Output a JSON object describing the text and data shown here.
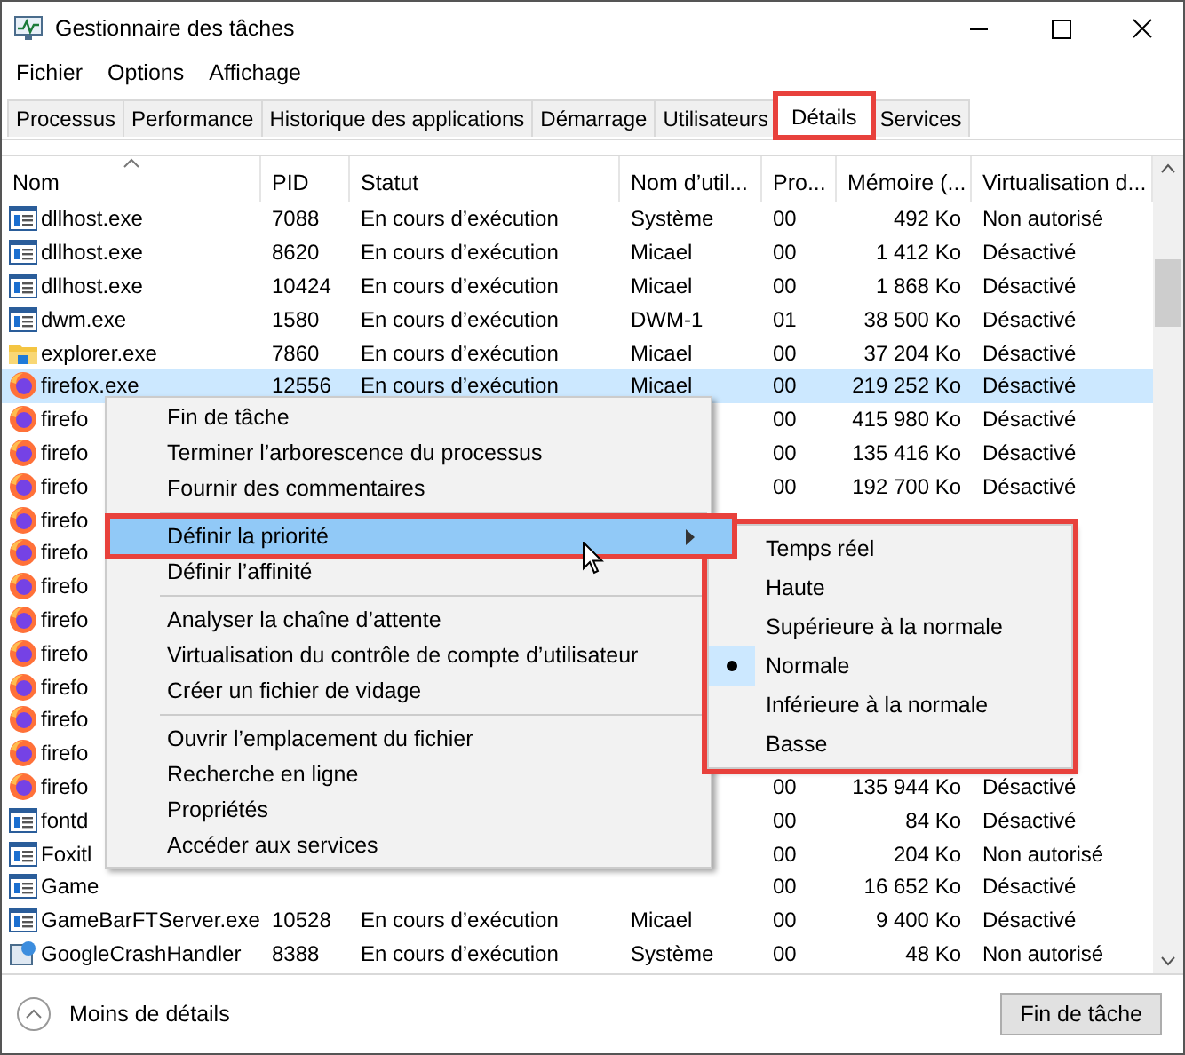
{
  "window": {
    "title": "Gestionnaire des tâches"
  },
  "menu_bar": [
    "Fichier",
    "Options",
    "Affichage"
  ],
  "tabs": [
    {
      "label": "Processus",
      "selected": false,
      "highlighted": false
    },
    {
      "label": "Performance",
      "selected": false,
      "highlighted": false
    },
    {
      "label": "Historique des applications",
      "selected": false,
      "highlighted": false
    },
    {
      "label": "Démarrage",
      "selected": false,
      "highlighted": false
    },
    {
      "label": "Utilisateurs",
      "selected": false,
      "highlighted": false
    },
    {
      "label": "Détails",
      "selected": true,
      "highlighted": true
    },
    {
      "label": "Services",
      "selected": false,
      "highlighted": false
    }
  ],
  "table": {
    "columns": [
      {
        "label": "Nom",
        "sorted": true
      },
      {
        "label": "PID",
        "sorted": false
      },
      {
        "label": "Statut",
        "sorted": false
      },
      {
        "label": "Nom d’util...",
        "sorted": false
      },
      {
        "label": "Pro...",
        "sorted": false
      },
      {
        "label": "Mémoire (...",
        "sorted": false
      },
      {
        "label": "Virtualisation d...",
        "sorted": false
      }
    ],
    "rows": [
      {
        "kind": "app",
        "selected": false,
        "name": "dllhost.exe",
        "pid": "7088",
        "status": "En cours d’exécution",
        "user": "Système",
        "cpu": "00",
        "memory": "492 Ko",
        "virtualization": "Non autorisé"
      },
      {
        "kind": "app",
        "selected": false,
        "name": "dllhost.exe",
        "pid": "8620",
        "status": "En cours d’exécution",
        "user": "Micael",
        "cpu": "00",
        "memory": "1 412 Ko",
        "virtualization": "Désactivé"
      },
      {
        "kind": "app",
        "selected": false,
        "name": "dllhost.exe",
        "pid": "10424",
        "status": "En cours d’exécution",
        "user": "Micael",
        "cpu": "00",
        "memory": "1 868 Ko",
        "virtualization": "Désactivé"
      },
      {
        "kind": "app",
        "selected": false,
        "name": "dwm.exe",
        "pid": "1580",
        "status": "En cours d’exécution",
        "user": "DWM-1",
        "cpu": "01",
        "memory": "38 500 Ko",
        "virtualization": "Désactivé"
      },
      {
        "kind": "folder",
        "selected": false,
        "name": "explorer.exe",
        "pid": "7860",
        "status": "En cours d’exécution",
        "user": "Micael",
        "cpu": "00",
        "memory": "37 204 Ko",
        "virtualization": "Désactivé"
      },
      {
        "kind": "firefox",
        "selected": true,
        "name": "firefox.exe",
        "pid": "12556",
        "status": "En cours d’exécution",
        "user": "Micael",
        "cpu": "00",
        "memory": "219 252 Ko",
        "virtualization": "Désactivé"
      },
      {
        "kind": "firefox",
        "selected": false,
        "name": "firefo",
        "cpu": "00",
        "memory": "415 980 Ko",
        "virtualization": "Désactivé"
      },
      {
        "kind": "firefox",
        "selected": false,
        "name": "firefo",
        "cpu": "00",
        "memory": "135 416 Ko",
        "virtualization": "Désactivé"
      },
      {
        "kind": "firefox",
        "selected": false,
        "name": "firefo",
        "cpu": "00",
        "memory": "192 700 Ko",
        "virtualization": "Désactivé"
      },
      {
        "kind": "firefox",
        "selected": false,
        "name": "firefo"
      },
      {
        "kind": "firefox",
        "selected": false,
        "name": "firefo"
      },
      {
        "kind": "firefox",
        "selected": false,
        "name": "firefo"
      },
      {
        "kind": "firefox",
        "selected": false,
        "name": "firefo"
      },
      {
        "kind": "firefox",
        "selected": false,
        "name": "firefo"
      },
      {
        "kind": "firefox",
        "selected": false,
        "name": "firefo"
      },
      {
        "kind": "firefox",
        "selected": false,
        "name": "firefo"
      },
      {
        "kind": "firefox",
        "selected": false,
        "name": "firefo"
      },
      {
        "kind": "firefox",
        "selected": false,
        "name": "firefo",
        "cpu": "00",
        "memory": "135 944 Ko",
        "virtualization": "Désactivé"
      },
      {
        "kind": "app",
        "selected": false,
        "name": "fontd",
        "cpu": "00",
        "memory": "84 Ko",
        "virtualization": "Désactivé"
      },
      {
        "kind": "app",
        "selected": false,
        "name": "Foxitl",
        "cpu": "00",
        "memory": "204 Ko",
        "virtualization": "Non autorisé"
      },
      {
        "kind": "app",
        "selected": false,
        "name": "Game",
        "cpu": "00",
        "memory": "16 652 Ko",
        "virtualization": "Désactivé"
      },
      {
        "kind": "app",
        "selected": false,
        "name": "GameBarFTServer.exe",
        "pid": "10528",
        "status": "En cours d’exécution",
        "user": "Micael",
        "cpu": "00",
        "memory": "9 400 Ko",
        "virtualization": "Désactivé"
      },
      {
        "kind": "setup",
        "selected": false,
        "name": "GoogleCrashHandler",
        "pid": "8388",
        "status": "En cours d’exécution",
        "user": "Système",
        "cpu": "00",
        "memory": "48 Ko",
        "virtualization": "Non autorisé"
      }
    ]
  },
  "context_menu": {
    "groups": [
      [
        {
          "label": "Fin de tâche",
          "selected": false,
          "submenu": false,
          "highlighted": false
        },
        {
          "label": "Terminer l’arborescence du processus",
          "selected": false,
          "submenu": false,
          "highlighted": false
        },
        {
          "label": "Fournir des commentaires",
          "selected": false,
          "submenu": false,
          "highlighted": false
        }
      ],
      [
        {
          "label": "Définir la priorité",
          "selected": true,
          "submenu": true,
          "highlighted": true
        },
        {
          "label": "Définir l’affinité",
          "selected": false,
          "submenu": false,
          "highlighted": false
        }
      ],
      [
        {
          "label": "Analyser la chaîne d’attente",
          "selected": false,
          "submenu": false,
          "highlighted": false
        },
        {
          "label": "Virtualisation du contrôle de compte d’utilisateur",
          "selected": false,
          "submenu": false,
          "highlighted": false
        },
        {
          "label": "Créer un fichier de vidage",
          "selected": false,
          "submenu": false,
          "highlighted": false
        }
      ],
      [
        {
          "label": "Ouvrir l’emplacement du fichier",
          "selected": false,
          "submenu": false,
          "highlighted": false
        },
        {
          "label": "Recherche en ligne",
          "selected": false,
          "submenu": false,
          "highlighted": false
        },
        {
          "label": "Propriétés",
          "selected": false,
          "submenu": false,
          "highlighted": false
        },
        {
          "label": "Accéder aux services",
          "selected": false,
          "submenu": false,
          "highlighted": false
        }
      ]
    ]
  },
  "priority_submenu": {
    "highlighted": true,
    "items": [
      {
        "label": "Temps réel",
        "checked": false
      },
      {
        "label": "Haute",
        "checked": false
      },
      {
        "label": "Supérieure à la normale",
        "checked": false
      },
      {
        "label": "Normale",
        "checked": true
      },
      {
        "label": "Inférieure à la normale",
        "checked": false
      },
      {
        "label": "Basse",
        "checked": false
      }
    ]
  },
  "footer": {
    "toggle": "Moins de détails",
    "button": "Fin de tâche"
  }
}
